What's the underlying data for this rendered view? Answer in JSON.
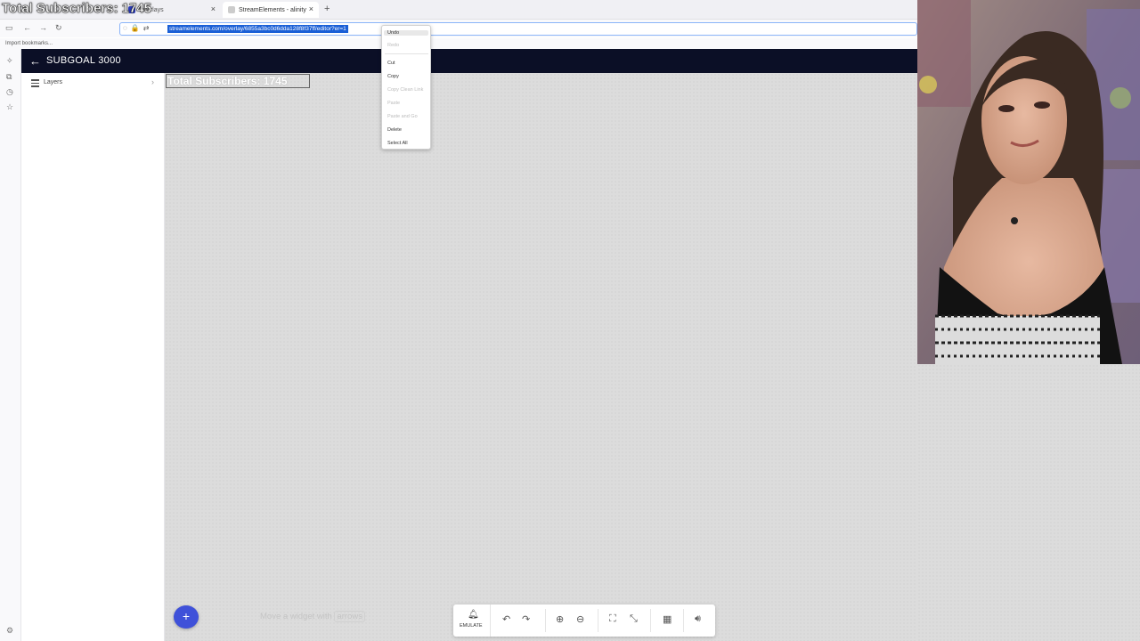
{
  "overlay_text": "Total Subscribers: 1745",
  "browser": {
    "tabs": [
      {
        "label": "Total Subscribers: 1745"
      },
      {
        "label": "Overlays"
      },
      {
        "label": "StreamElements - alinity"
      }
    ],
    "url": "streamelements.com/overlay/6855a3bc0d6dda128f8f37ff/editor?er=1",
    "bookmarks_label": "Import bookmarks..."
  },
  "context_menu": {
    "items": [
      {
        "label": "Undo",
        "state": "highlighted"
      },
      {
        "label": "Redo",
        "state": "disabled"
      },
      {
        "label": "Cut",
        "state": "enabled"
      },
      {
        "label": "Copy",
        "state": "enabled"
      },
      {
        "label": "Copy Clean Link",
        "state": "disabled"
      },
      {
        "label": "Paste",
        "state": "disabled"
      },
      {
        "label": "Paste and Go",
        "state": "disabled"
      },
      {
        "label": "Delete",
        "state": "enabled"
      },
      {
        "label": "Select All",
        "state": "enabled"
      }
    ]
  },
  "app": {
    "title": "SUBGOAL 3000",
    "layers_label": "Layers"
  },
  "canvas": {
    "widget_text": "Total Subscribers: 1745",
    "hint_prefix": "Move a widget with",
    "hint_key": "arrows"
  },
  "toolbar": {
    "emulate_label": "EMULATE"
  },
  "colors": {
    "header_bg": "#0b0f26",
    "accent": "#3f51d9",
    "selection": "#1a5fd6"
  }
}
